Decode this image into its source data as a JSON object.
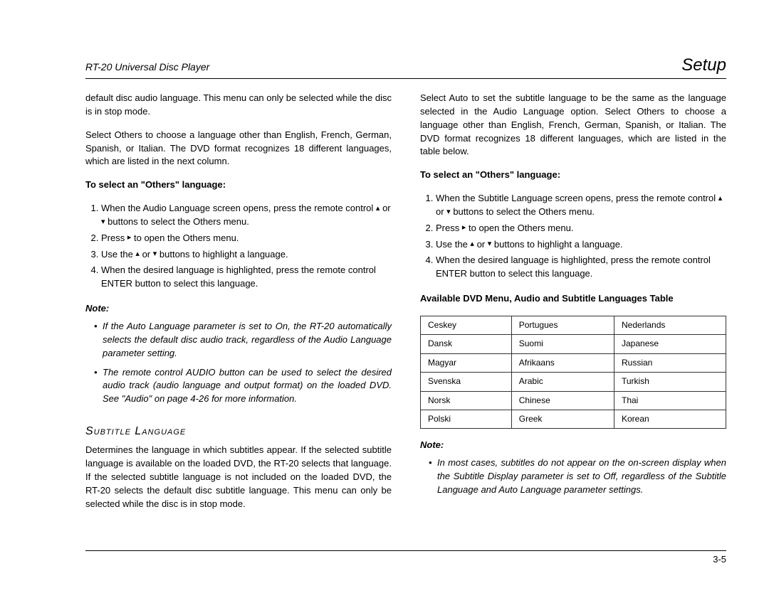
{
  "header": {
    "product": "RT-20 Universal Disc Player",
    "chapter": "Setup"
  },
  "left": {
    "intro1": "default disc audio language. This menu can only be selected while the disc is in stop mode.",
    "intro2": "Select Others to choose a language other than English, French, German, Spanish, or Italian. The DVD format recognizes 18 different languages, which are listed in the next column.",
    "others_heading": "To select an \"Others\" language:",
    "steps": {
      "s1a": "When the Audio Language screen opens, press the remote control ",
      "s1b": " or ",
      "s1c": " buttons to select the Others menu.",
      "s2a": "Press ",
      "s2b": " to open the Others menu.",
      "s3a": "Use the ",
      "s3b": " or ",
      "s3c": " buttons to highlight a language.",
      "s4": "When the desired language is highlighted, press the remote control ENTER button to select this language."
    },
    "note_label": "Note:",
    "note_items": [
      "If the Auto Language parameter is set to On, the RT-20 automatically selects the default disc audio track, regardless of the Audio Language parameter setting.",
      "The remote control AUDIO button can be used to select the desired audio track (audio language and output format) on the loaded DVD. See \"Audio\" on page 4-26 for more information."
    ],
    "subtitle_heading": "Subtitle Language",
    "subtitle_body": "Determines the language in which subtitles appear. If the selected subtitle language is available on the loaded DVD, the RT-20 selects that language. If the selected subtitle language is not included on the loaded DVD, the RT-20 selects the default disc subtitle language. This menu can only be selected while the disc is in stop mode."
  },
  "right": {
    "intro": "Select Auto to set the subtitle language to be the same as the language selected in the Audio Language option. Select Others to choose a language other than English, French, German, Spanish, or Italian. The DVD format recognizes 18 different languages, which are listed in the table below.",
    "others_heading": "To select an \"Others\" language:",
    "steps": {
      "s1a": "When the Subtitle Language screen opens, press the remote control ",
      "s1b": " or ",
      "s1c": " buttons to select the Others menu.",
      "s2a": "Press ",
      "s2b": " to open the Others menu.",
      "s3a": "Use the ",
      "s3b": " or ",
      "s3c": " buttons to highlight a language.",
      "s4": "When the desired language is highlighted, press the remote control ENTER button to select this language."
    },
    "table_heading": "Available DVD Menu, Audio and Subtitle Languages Table",
    "table": [
      [
        "Ceskey",
        "Portugues",
        "Nederlands"
      ],
      [
        "Dansk",
        "Suomi",
        "Japanese"
      ],
      [
        "Magyar",
        "Afrikaans",
        "Russian"
      ],
      [
        "Svenska",
        "Arabic",
        "Turkish"
      ],
      [
        "Norsk",
        "Chinese",
        "Thai"
      ],
      [
        "Polski",
        "Greek",
        "Korean"
      ]
    ],
    "note_label": "Note:",
    "note_items": [
      "In most cases, subtitles do not appear on the on-screen display when the Subtitle Display parameter is set to Off, regardless of the Subtitle Language and Auto Language parameter settings."
    ]
  },
  "icons": {
    "up": "▴",
    "down": "▾",
    "right": "▸"
  },
  "footer": {
    "page_number": "3-5"
  }
}
